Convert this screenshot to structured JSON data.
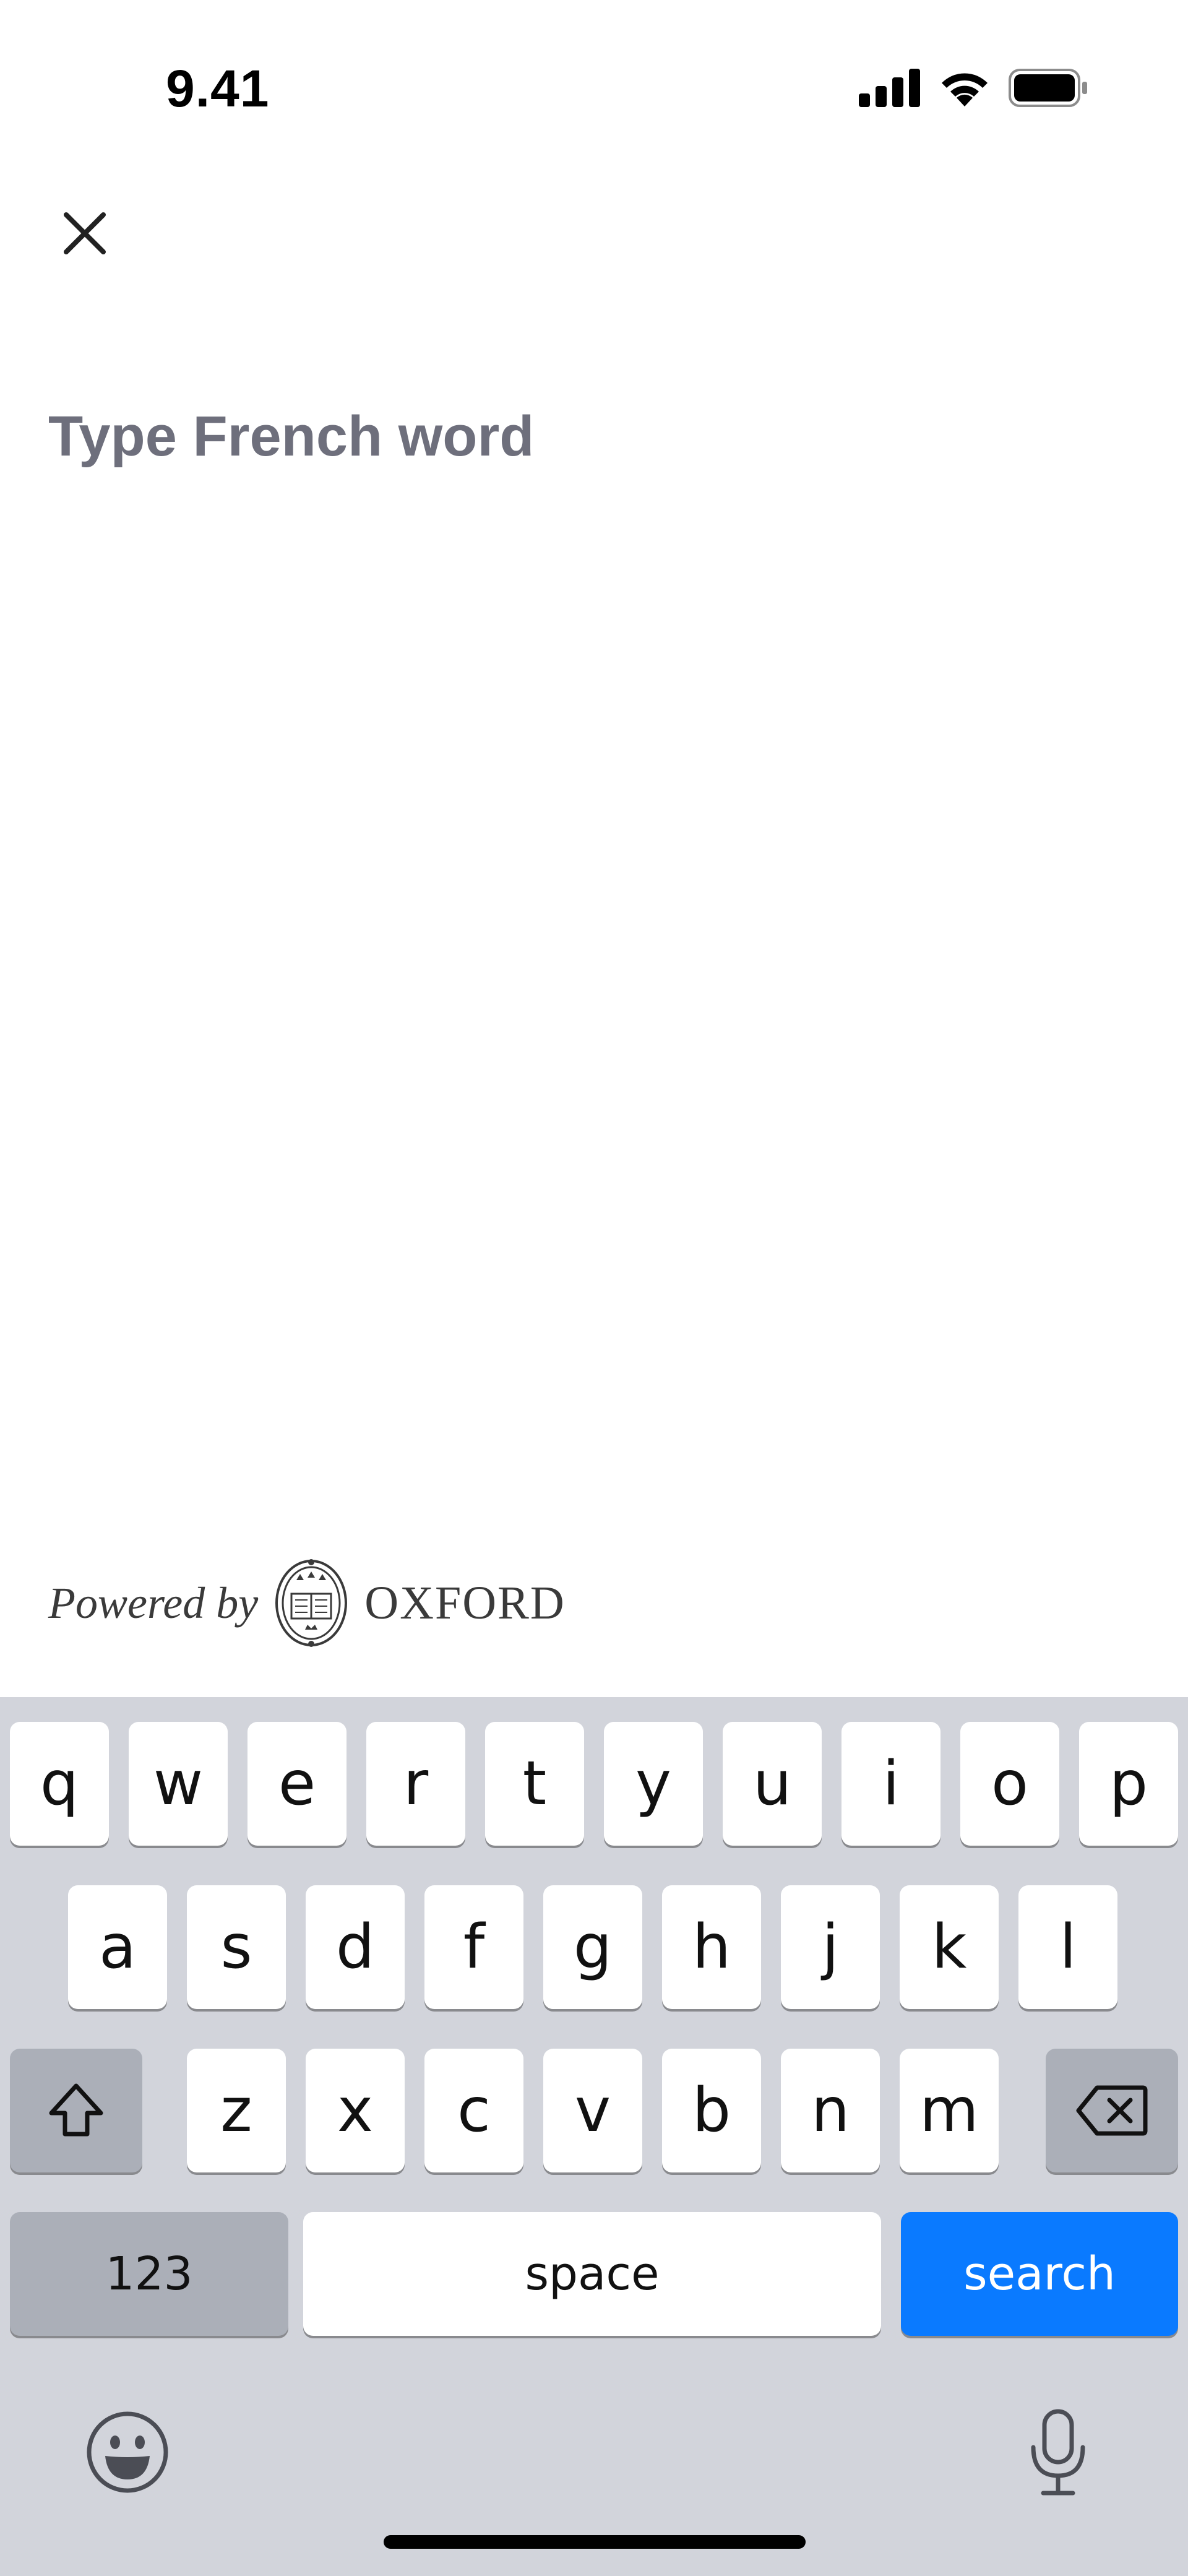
{
  "status_bar": {
    "time": "9.41",
    "icons": [
      "cellular-signal-icon",
      "wifi-icon",
      "battery-icon"
    ]
  },
  "header": {
    "close_icon": "close-icon"
  },
  "search": {
    "value": "",
    "placeholder": "Type French word"
  },
  "footer": {
    "powered_by": "Powered by",
    "brand": "OXFORD",
    "logo_icon": "oxford-crest-icon"
  },
  "keyboard": {
    "row1": [
      "q",
      "w",
      "e",
      "r",
      "t",
      "y",
      "u",
      "i",
      "o",
      "p"
    ],
    "row2": [
      "a",
      "s",
      "d",
      "f",
      "g",
      "h",
      "j",
      "k",
      "l"
    ],
    "row3": [
      "z",
      "x",
      "c",
      "v",
      "b",
      "n",
      "m"
    ],
    "shift_icon": "shift-icon",
    "backspace_icon": "backspace-icon",
    "numbers_label": "123",
    "space_label": "space",
    "search_label": "search",
    "emoji_icon": "emoji-icon",
    "mic_icon": "microphone-icon"
  },
  "colors": {
    "accent": "#0a7aff",
    "keyboard_bg": "#d2d4db",
    "placeholder": "#6e6f7c"
  }
}
